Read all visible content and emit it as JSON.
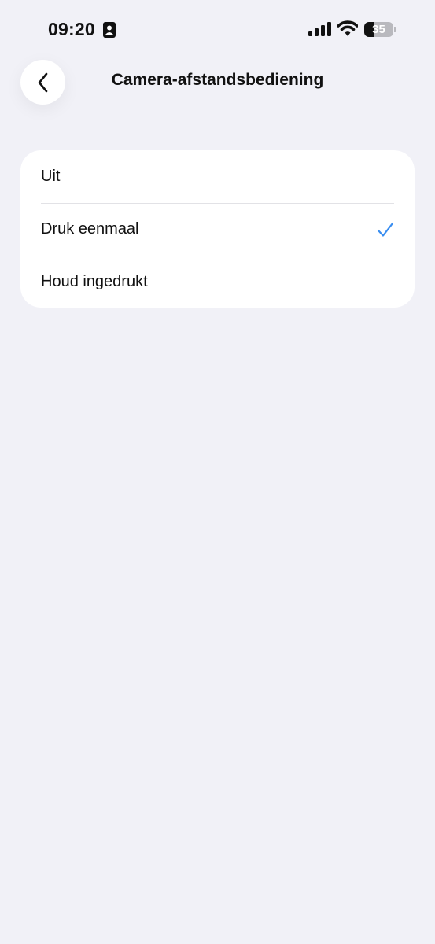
{
  "status_bar": {
    "time": "09:20",
    "battery_text": "35",
    "battery_level": 0.35,
    "icons": [
      "contact-card-icon",
      "signal-icon",
      "wifi-icon",
      "battery-icon"
    ]
  },
  "header": {
    "title": "Camera-afstandsbediening",
    "back_icon": "chevron-left-icon"
  },
  "options": [
    {
      "label": "Uit",
      "selected": false
    },
    {
      "label": "Druk eenmaal",
      "selected": true
    },
    {
      "label": "Houd ingedrukt",
      "selected": false
    }
  ],
  "colors": {
    "background": "#f1f1f7",
    "card": "#ffffff",
    "accent": "#3a8ef0",
    "text": "#111111"
  }
}
